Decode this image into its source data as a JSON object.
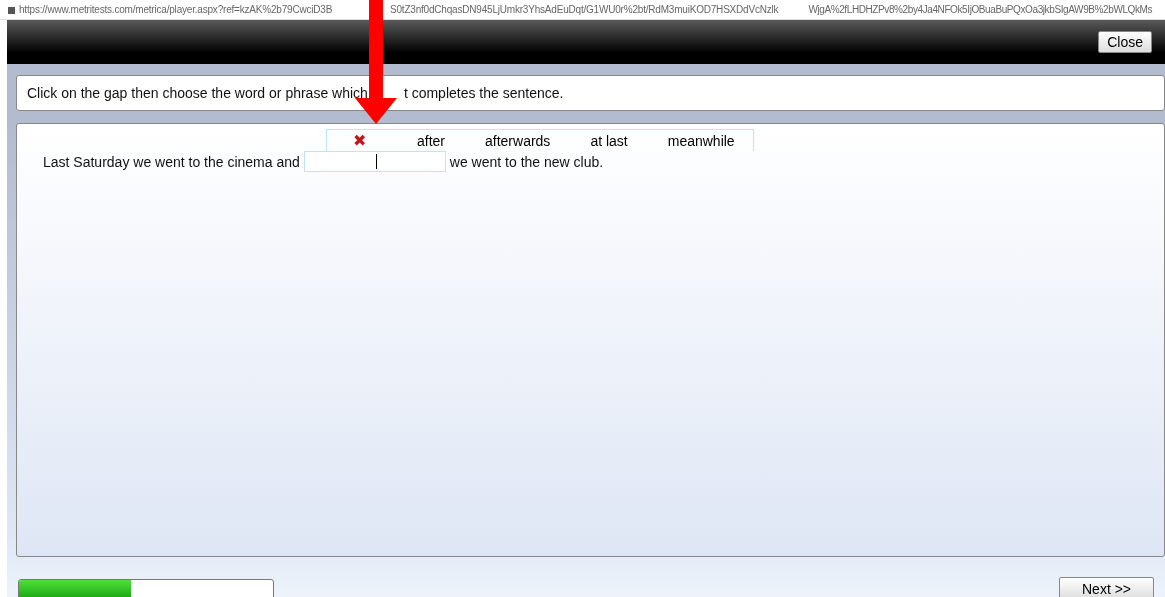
{
  "address_bar": {
    "url_segments": [
      "https://www.metritests.com/metrica/player.aspx?ref=kzAK%2b79CwciD3B",
      "S0tZ3nf0dChqasDN945LjUmkr3YhsAdEuDqt/G1WU0r%2bt/RdM3muiKOD7HSXDdVcNzlk",
      "WjgA%2fLHDHZPv8%2by4Ja4NFOk5IjOBuaBuPQxOa3jkbSIgAW9B%2bWLQkMs"
    ]
  },
  "header": {
    "close_button": "Close"
  },
  "instruction": {
    "segments": [
      "Click on the gap then choose the word or phrase which",
      "t completes the sentence."
    ]
  },
  "word_bank": {
    "clear_icon": "✖",
    "words": [
      "after",
      "afterwards",
      "at last",
      "meanwhile"
    ]
  },
  "sentence": {
    "before": "Last Saturday we went to the cinema and",
    "after": "we went to the new club."
  },
  "footer": {
    "progress": {
      "level": 0.44
    },
    "next_button": "Next >>"
  },
  "annotation": {
    "kind": "arrow"
  }
}
